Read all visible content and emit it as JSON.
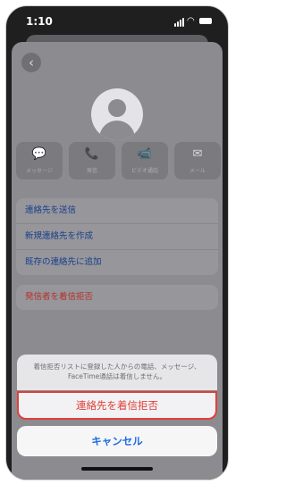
{
  "status_bar": {
    "time": "1:10"
  },
  "contact": {
    "actions": [
      {
        "icon": "message-icon",
        "glyph": "💬",
        "label": "メッセージ"
      },
      {
        "icon": "phone-icon",
        "glyph": "📞",
        "label": "発信"
      },
      {
        "icon": "video-icon",
        "glyph": "📹",
        "label": "ビデオ通話"
      },
      {
        "icon": "mail-icon",
        "glyph": "✉",
        "label": "メール"
      }
    ],
    "menu": [
      "連絡先を送信",
      "新規連絡先を作成",
      "既存の連絡先に追加"
    ],
    "block_caller": "発信者を着信拒否"
  },
  "action_sheet": {
    "message_line1": "着信拒否リストに登録した人からの電話、メッセージ、",
    "message_line2": "FaceTime通話は着信しません。",
    "block_label": "連絡先を着信拒否",
    "cancel_label": "キャンセル"
  },
  "colors": {
    "destructive": "#e0403a",
    "accent": "#1f6ce0"
  }
}
